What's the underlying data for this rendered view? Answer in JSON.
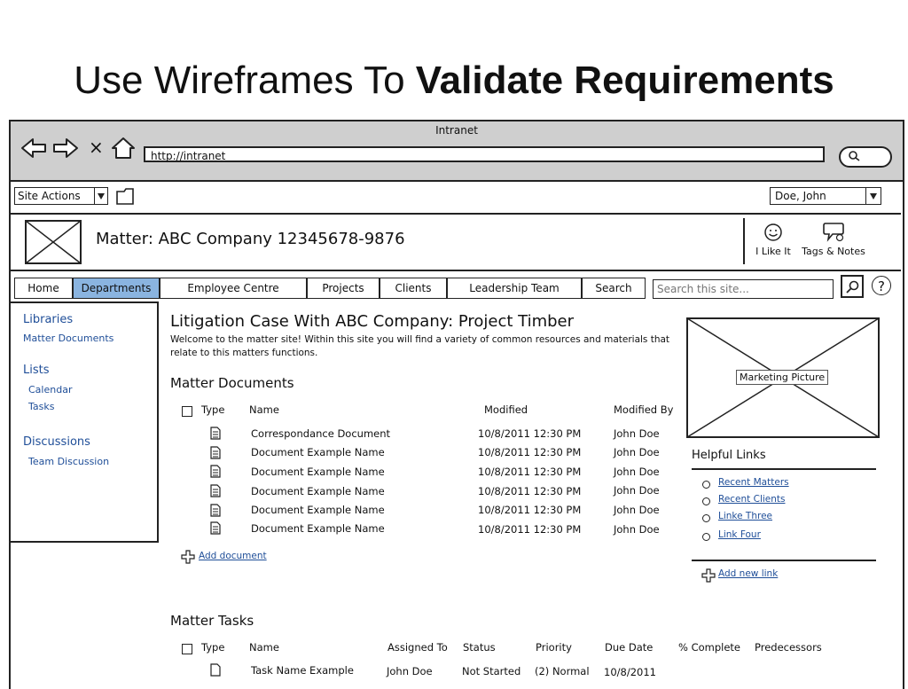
{
  "slide": {
    "title_regular": "Use Wireframes To ",
    "title_bold": "Validate Requirements"
  },
  "browser": {
    "window_title": "Intranet",
    "url": "http://intranet",
    "close_glyph": "×"
  },
  "site_bar": {
    "site_actions": "Site Actions",
    "user": "Doe, John"
  },
  "header": {
    "matter_title": "Matter: ABC Company 12345678-9876",
    "like_label": "I Like It",
    "tags_label": "Tags & Notes"
  },
  "nav": {
    "tabs": [
      "Home",
      "Departments",
      "Employee Centre",
      "Projects",
      "Clients",
      "Leadership Team",
      "Search"
    ],
    "search_placeholder": "Search this site...",
    "help_glyph": "?"
  },
  "sidebar": {
    "libraries_heading": "Libraries",
    "libraries_items": [
      "Matter Documents"
    ],
    "lists_heading": "Lists",
    "lists_items": [
      "Calendar",
      "Tasks"
    ],
    "discussions_heading": "Discussions",
    "discussions_items": [
      "Team Discussion"
    ]
  },
  "main": {
    "page_title": "Litigation Case With ABC Company: Project Timber",
    "intro_line1": "Welcome to the matter site! Within this site you will find a variety of common resources and materials that",
    "intro_line2": "relate to this matters functions.",
    "documents": {
      "heading": "Matter Documents",
      "columns": [
        "Type",
        "Name",
        "Modified",
        "Modified By"
      ],
      "rows": [
        {
          "name": "Correspondance Document",
          "modified": "10/8/2011 12:30 PM",
          "by": "John Doe"
        },
        {
          "name": "Document Example Name",
          "modified": "10/8/2011 12:30 PM",
          "by": "John Doe"
        },
        {
          "name": "Document Example Name",
          "modified": "10/8/2011 12:30 PM",
          "by": "John Doe"
        },
        {
          "name": "Document Example Name",
          "modified": "10/8/2011 12:30 PM",
          "by": "John Doe"
        },
        {
          "name": "Document Example Name",
          "modified": "10/8/2011 12:30 PM",
          "by": "John Doe"
        },
        {
          "name": "Document Example Name",
          "modified": "10/8/2011 12:30 PM",
          "by": "John Doe"
        }
      ],
      "add_label": "Add document"
    },
    "tasks": {
      "heading": "Matter Tasks",
      "columns": [
        "Type",
        "Name",
        "Assigned To",
        "Status",
        "Priority",
        "Due Date",
        "% Complete",
        "Predecessors"
      ],
      "rows": [
        {
          "name": "Task Name Example",
          "assigned": "John Doe",
          "status": "Not Started",
          "priority": "(2) Normal",
          "due": "10/8/2011"
        }
      ]
    }
  },
  "right": {
    "marketing_label": "Marketing Picture",
    "helpful_heading": "Helpful Links",
    "links": [
      "Recent Matters",
      "Recent Clients",
      "Linke Three",
      "Link Four"
    ],
    "add_link_label": "Add new link"
  }
}
